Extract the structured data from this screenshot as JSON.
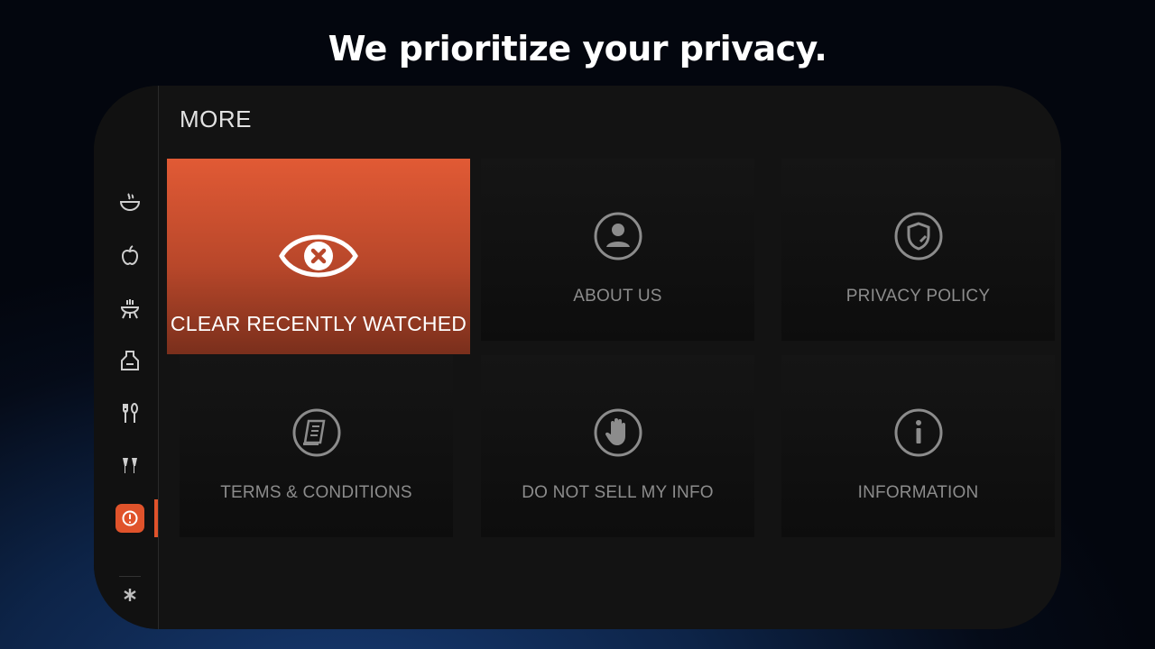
{
  "headline": "We prioritize your privacy.",
  "section_title": "MORE",
  "rail": {
    "items": [
      {
        "icon": "bowl-icon"
      },
      {
        "icon": "apple-icon"
      },
      {
        "icon": "grill-icon"
      },
      {
        "icon": "apron-icon"
      },
      {
        "icon": "fork-spoon-icon"
      },
      {
        "icon": "wine-glass-icon"
      },
      {
        "icon": "info-circle-icon",
        "active": true
      },
      {
        "icon": "asterisk-icon"
      }
    ]
  },
  "tiles": [
    {
      "label": "CLEAR RECENTLY WATCHED",
      "icon": "eye-x-icon",
      "focused": true
    },
    {
      "label": "ABOUT US",
      "icon": "person-icon"
    },
    {
      "label": "PRIVACY POLICY",
      "icon": "shield-icon"
    },
    {
      "label": "TERMS & CONDITIONS",
      "icon": "document-icon"
    },
    {
      "label": "DO NOT SELL MY INFO",
      "icon": "hand-icon"
    },
    {
      "label": "INFORMATION",
      "icon": "info-icon"
    }
  ],
  "colors": {
    "accent": "#e0532b",
    "background": "#131313",
    "text_muted": "#8c8c8c"
  }
}
